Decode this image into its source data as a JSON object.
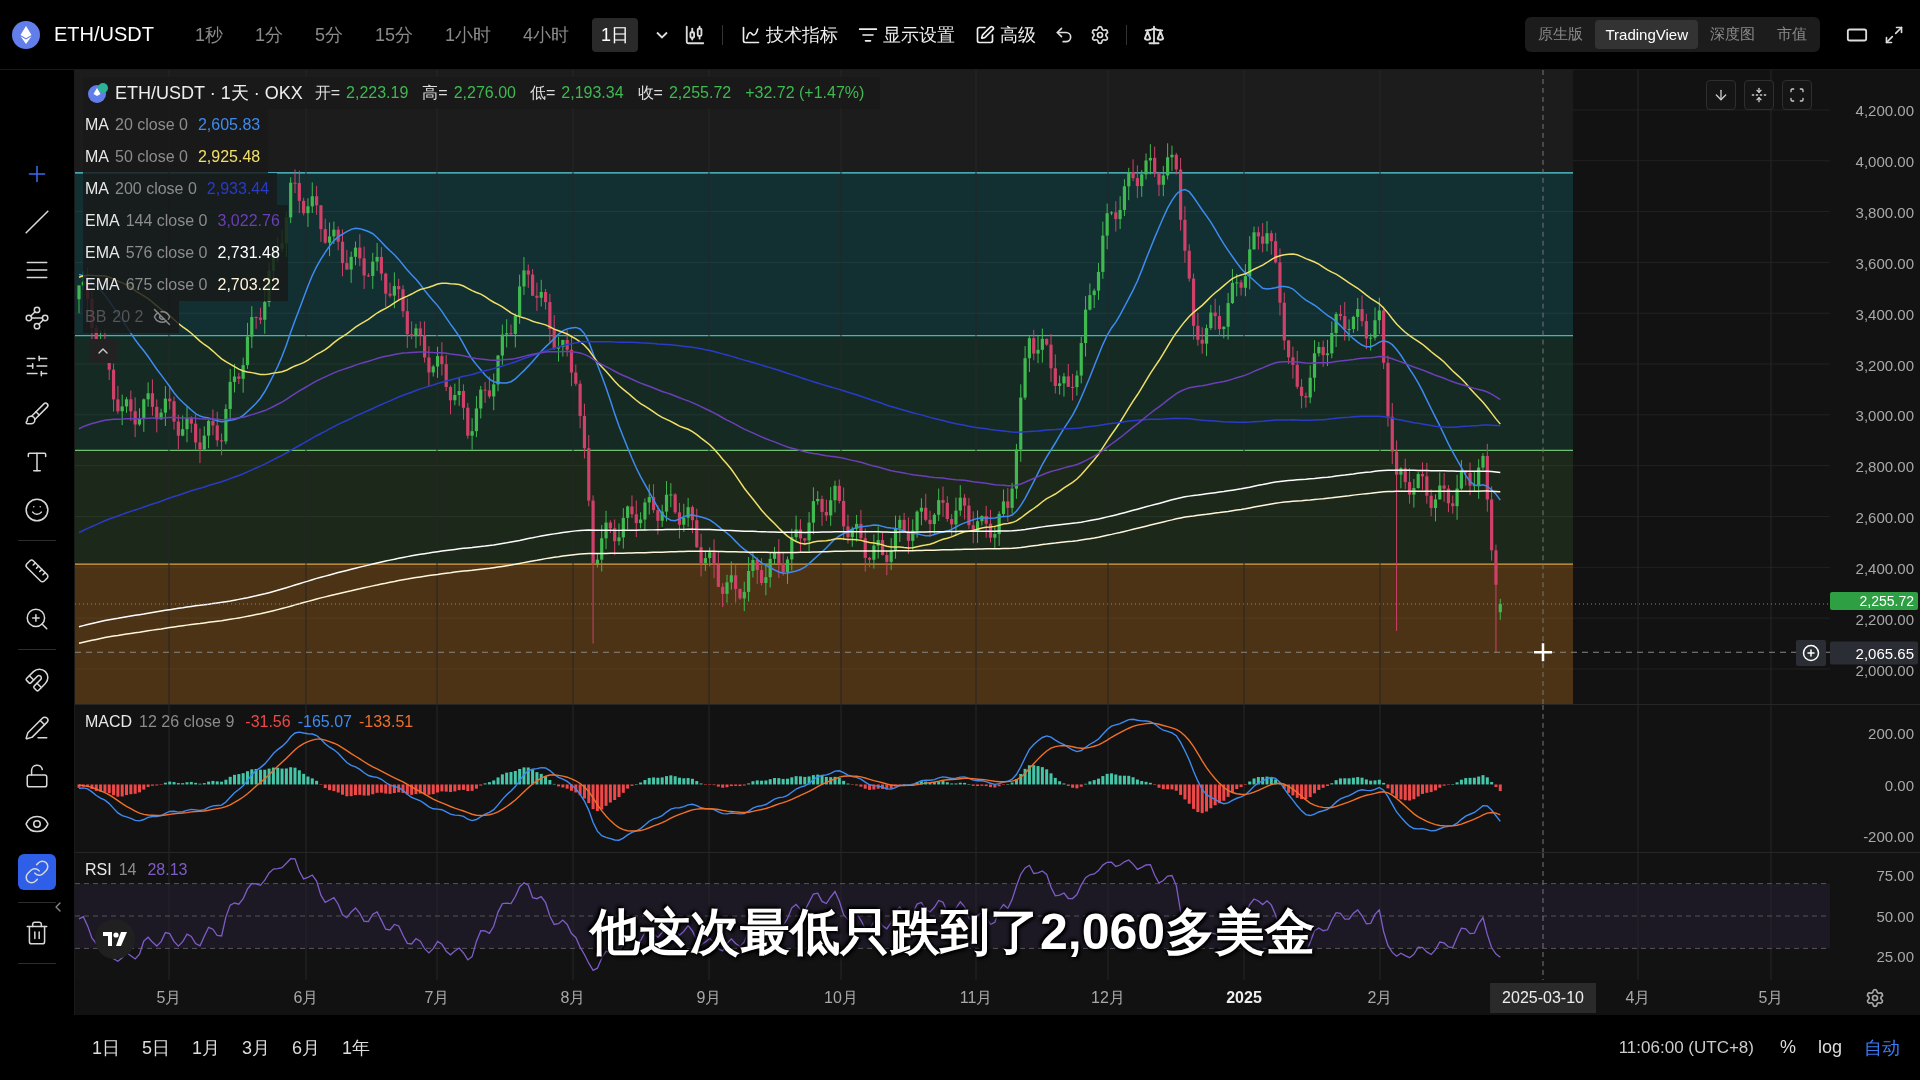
{
  "top_bar": {
    "pair": "ETH/USDT",
    "intervals": [
      {
        "label": "1秒",
        "selected": false
      },
      {
        "label": "1分",
        "selected": false
      },
      {
        "label": "5分",
        "selected": false
      },
      {
        "label": "15分",
        "selected": false
      },
      {
        "label": "1小时",
        "selected": false
      },
      {
        "label": "4小时",
        "selected": false
      },
      {
        "label": "1日",
        "selected": true
      }
    ],
    "menus": [
      "技术指标",
      "显示设置",
      "高级"
    ],
    "views": [
      {
        "label": "原生版",
        "selected": false
      },
      {
        "label": "TradingView",
        "selected": true
      },
      {
        "label": "深度图",
        "selected": false
      },
      {
        "label": "市值",
        "selected": false
      }
    ]
  },
  "toolbar": {
    "groups": [
      [
        {
          "selected": true,
          "on": false
        },
        {
          "selected": false,
          "on": false
        },
        {
          "selected": false,
          "on": false
        },
        {
          "selected": false,
          "on": false
        },
        {
          "selected": false,
          "on": false
        },
        {
          "selected": false,
          "on": false
        },
        {
          "selected": false,
          "on": false
        },
        {
          "selected": false,
          "on": false
        }
      ],
      [
        {
          "selected": false,
          "on": false
        },
        {
          "selected": false,
          "on": false
        }
      ],
      [
        {
          "selected": false,
          "on": false
        },
        {
          "selected": false,
          "on": false
        },
        {
          "selected": false,
          "on": false
        },
        {
          "selected": false,
          "on": false
        },
        {
          "selected": false,
          "on": true
        }
      ],
      [
        {
          "selected": false,
          "on": false
        }
      ]
    ]
  },
  "legend": {
    "title": "ETH/USDT · 1天 · OKX",
    "ohlc": [
      {
        "label": "开=",
        "value": "2,223.19"
      },
      {
        "label": "高=",
        "value": "2,276.00"
      },
      {
        "label": "低=",
        "value": "2,193.34"
      },
      {
        "label": "收=",
        "value": "2,255.72"
      }
    ],
    "change": "+32.72 (+1.47%)",
    "indicators": [
      {
        "name": "MA",
        "params": "20 close 0",
        "value": "2,605.83",
        "color": "#3d8bf0"
      },
      {
        "name": "MA",
        "params": "50 close 0",
        "value": "2,925.48",
        "color": "#f0e068"
      },
      {
        "name": "MA",
        "params": "200 close 0",
        "value": "2,933.44",
        "color": "#2a3bc8"
      },
      {
        "name": "EMA",
        "params": "144 close 0",
        "value": "3,022.76",
        "color": "#6a3fb8"
      },
      {
        "name": "EMA",
        "params": "576 close 0",
        "value": "2,731.48",
        "color": "#ffffff"
      },
      {
        "name": "EMA",
        "params": "675 close 0",
        "value": "2,703.22",
        "color": "#fff6dc"
      }
    ],
    "hidden_indicator": {
      "name": "BB",
      "params": "20 2"
    }
  },
  "price_axis": {
    "ticks": [
      "4,200.00",
      "4,000.00",
      "3,800.00",
      "3,600.00",
      "3,400.00",
      "3,200.00",
      "3,000.00",
      "2,800.00",
      "2,600.00",
      "2,400.00",
      "2,200.00",
      "2,000.00"
    ],
    "last_price": "2,255.72",
    "crosshair_price": "2,065.65"
  },
  "macd": {
    "name": "MACD",
    "params": "12 26 close 9",
    "values": [
      {
        "value": "-31.56",
        "color": "#f04848"
      },
      {
        "value": "-165.07",
        "color": "#3d8bf0"
      },
      {
        "value": "-133.51",
        "color": "#f0702a"
      }
    ],
    "ticks": [
      "200.00",
      "0.00",
      "-200.00"
    ]
  },
  "rsi": {
    "name": "RSI",
    "params": "14",
    "value": "28.13",
    "color": "#7e5cc8",
    "ticks": [
      "75.00",
      "50.00",
      "25.00"
    ]
  },
  "caption": "他这次最低只跌到了2,060多美金",
  "time_axis": {
    "labels": [
      {
        "label": "5月",
        "bold": false
      },
      {
        "label": "6月",
        "bold": false
      },
      {
        "label": "7月",
        "bold": false
      },
      {
        "label": "8月",
        "bold": false
      },
      {
        "label": "9月",
        "bold": false
      },
      {
        "label": "10月",
        "bold": false
      },
      {
        "label": "11月",
        "bold": false
      },
      {
        "label": "12月",
        "bold": false
      },
      {
        "label": "2025",
        "bold": true
      },
      {
        "label": "2月",
        "bold": false
      },
      {
        "label": "4月",
        "bold": false
      },
      {
        "label": "5月",
        "bold": false
      }
    ],
    "crosshair_date": "2025-03-10"
  },
  "bottom_bar": {
    "ranges": [
      "1日",
      "5日",
      "1月",
      "3月",
      "6月",
      "1年"
    ],
    "time": "11:06:00 (UTC+8)",
    "scale_options": [
      {
        "label": "%",
        "selected": false
      },
      {
        "label": "log",
        "selected": false
      },
      {
        "label": "自动",
        "selected": true
      }
    ]
  }
}
